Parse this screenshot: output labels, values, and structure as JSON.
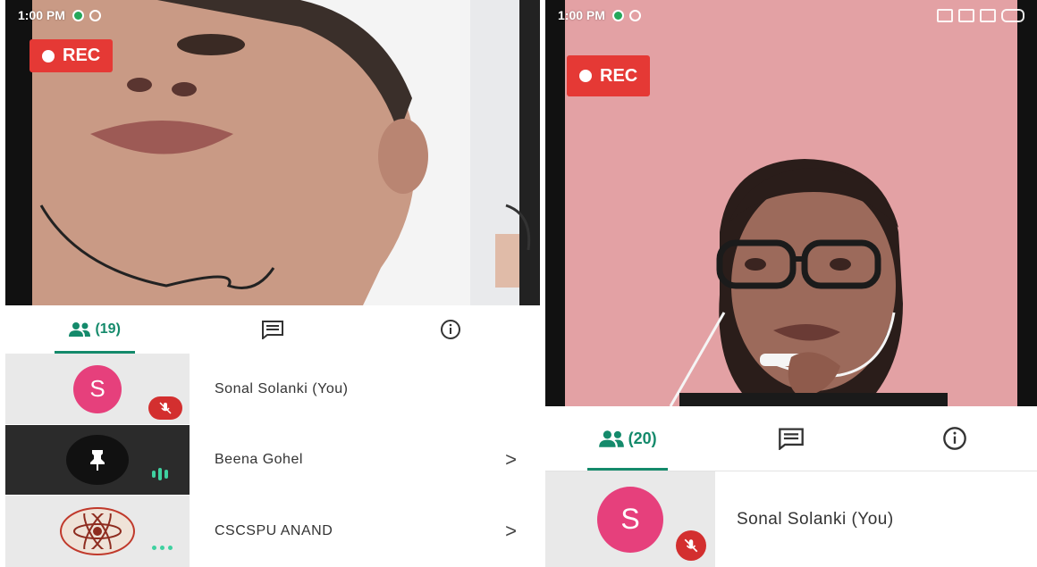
{
  "colors": {
    "accent": "#148a6b",
    "rec_red": "#e53935",
    "avatar_pink": "#e6407c",
    "mute_red": "#d32f2f"
  },
  "left_screen": {
    "status_bar": {
      "time": "1:00 PM"
    },
    "rec_label": "REC",
    "tabs": [
      {
        "icon": "people-icon",
        "count": "(19)"
      },
      {
        "icon": "chat-icon"
      },
      {
        "icon": "info-icon"
      }
    ],
    "participants": [
      {
        "name": "Sonal Solanki (You)",
        "avatar_letter": "S",
        "status_icon": "mic-off-icon"
      },
      {
        "name": "Beena Gohel",
        "avatar_icon": "pin-icon",
        "status_icon": "speaking-icon",
        "chevron": ">"
      },
      {
        "name": "CSCSPU ANAND",
        "avatar_icon": "atom-logo-icon",
        "status_icon": "more-icon",
        "chevron": ">"
      }
    ]
  },
  "right_screen": {
    "status_bar": {
      "time": "1:00 PM"
    },
    "rec_label": "REC",
    "tabs": [
      {
        "icon": "people-icon",
        "count": "(20)"
      },
      {
        "icon": "chat-icon"
      },
      {
        "icon": "info-icon"
      }
    ],
    "participants": [
      {
        "name": "Sonal Solanki (You)",
        "avatar_letter": "S",
        "status_icon": "mic-off-icon"
      }
    ]
  }
}
